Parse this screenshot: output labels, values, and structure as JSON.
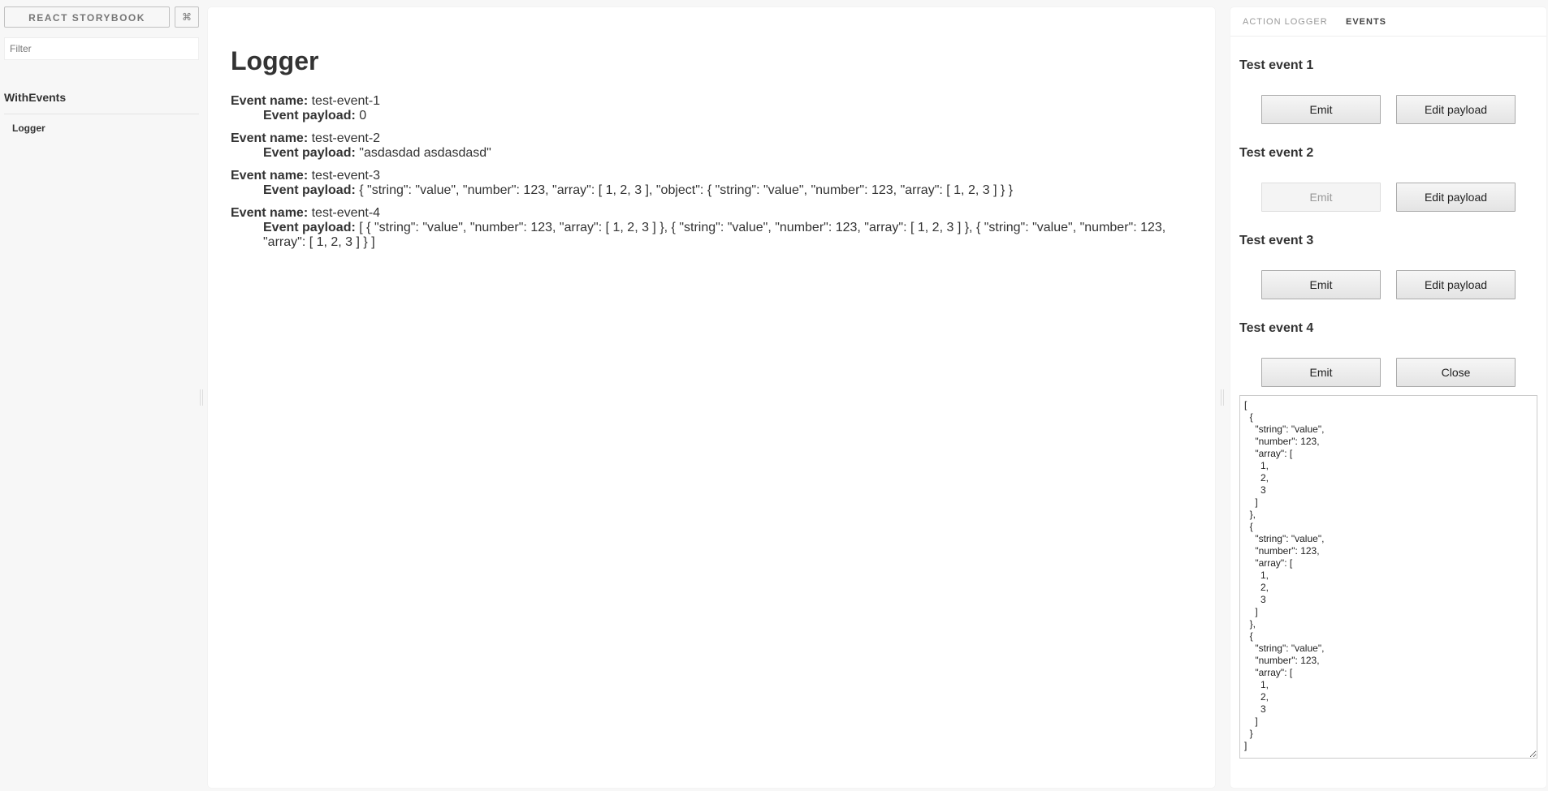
{
  "sidebar": {
    "brand_label": "REACT STORYBOOK",
    "shortcut_label": "⌘",
    "filter_placeholder": "Filter",
    "filter_value": "",
    "kinds": [
      {
        "title": "WithEvents",
        "stories": [
          {
            "label": "Logger",
            "selected": true
          }
        ]
      }
    ]
  },
  "preview": {
    "title": "Logger",
    "name_label": "Event name:",
    "payload_label": "Event payload:",
    "logs": [
      {
        "name": "test-event-1",
        "payload": "0"
      },
      {
        "name": "test-event-2",
        "payload": "\"asdasdad asdasdasd\""
      },
      {
        "name": "test-event-3",
        "payload": "{ \"string\": \"value\", \"number\": 123, \"array\": [ 1, 2, 3 ], \"object\": { \"string\": \"value\", \"number\": 123, \"array\": [ 1, 2, 3 ] } }"
      },
      {
        "name": "test-event-4",
        "payload": "[ { \"string\": \"value\", \"number\": 123, \"array\": [ 1, 2, 3 ] }, { \"string\": \"value\", \"number\": 123, \"array\": [ 1, 2, 3 ] }, { \"string\": \"value\", \"number\": 123, \"array\": [ 1, 2, 3 ] } ]"
      }
    ]
  },
  "panel": {
    "tabs": [
      {
        "label": "ACTION LOGGER",
        "active": false
      },
      {
        "label": "EVENTS",
        "active": true
      }
    ],
    "events": [
      {
        "title": "Test event 1",
        "emit_label": "Emit",
        "emit_disabled": false,
        "secondary_label": "Edit payload"
      },
      {
        "title": "Test event 2",
        "emit_label": "Emit",
        "emit_disabled": true,
        "secondary_label": "Edit payload"
      },
      {
        "title": "Test event 3",
        "emit_label": "Emit",
        "emit_disabled": false,
        "secondary_label": "Edit payload"
      },
      {
        "title": "Test event 4",
        "emit_label": "Emit",
        "emit_disabled": false,
        "secondary_label": "Close"
      }
    ],
    "payload_editor_value": "[\n  {\n    \"string\": \"value\",\n    \"number\": 123,\n    \"array\": [\n      1,\n      2,\n      3\n    ]\n  },\n  {\n    \"string\": \"value\",\n    \"number\": 123,\n    \"array\": [\n      1,\n      2,\n      3\n    ]\n  },\n  {\n    \"string\": \"value\",\n    \"number\": 123,\n    \"array\": [\n      1,\n      2,\n      3\n    ]\n  }\n]"
  }
}
